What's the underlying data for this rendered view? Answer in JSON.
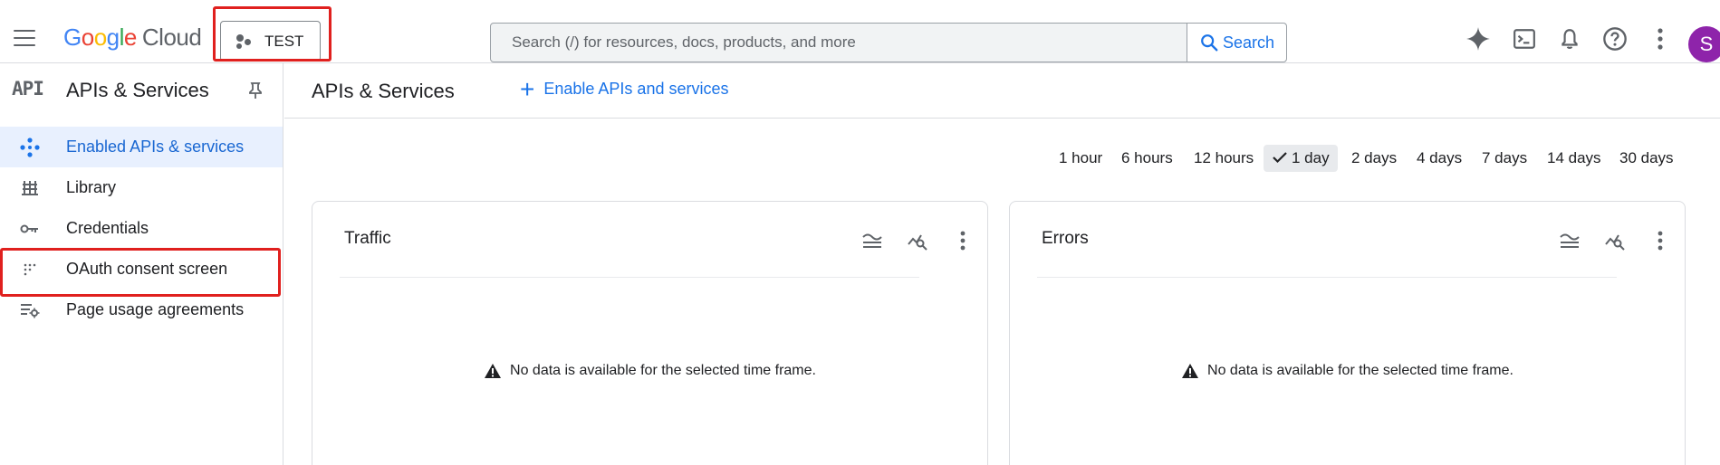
{
  "topbar": {
    "logo_google": [
      "G",
      "o",
      "o",
      "g",
      "l",
      "e"
    ],
    "logo_cloud": "Cloud",
    "project_label": "TEST",
    "search_placeholder": "Search (/) for resources, docs, products, and more",
    "search_button": "Search",
    "avatar_letter": "S"
  },
  "sidebar": {
    "badge": "API",
    "title": "APIs & Services",
    "items": [
      {
        "label": "Enabled APIs & services",
        "icon": "diamond-nodes-icon",
        "active": true
      },
      {
        "label": "Library",
        "icon": "library-icon",
        "active": false
      },
      {
        "label": "Credentials",
        "icon": "key-icon",
        "active": false
      },
      {
        "label": "OAuth consent screen",
        "icon": "consent-grid-icon",
        "active": false
      },
      {
        "label": "Page usage agreements",
        "icon": "settings-list-icon",
        "active": false
      }
    ]
  },
  "main": {
    "title": "APIs & Services",
    "enable_button": "Enable APIs and services",
    "time_ranges": [
      "1 hour",
      "6 hours",
      "12 hours",
      "1 day",
      "2 days",
      "4 days",
      "7 days",
      "14 days",
      "30 days"
    ],
    "selected_time_range": "1 day",
    "cards": [
      {
        "title": "Traffic",
        "message": "No data is available for the selected time frame."
      },
      {
        "title": "Errors",
        "message": "No data is available for the selected time frame."
      }
    ]
  },
  "colors": {
    "accent": "#1a73e8",
    "active_bg": "#e8f0fe",
    "highlight_box": "#e0201e",
    "avatar": "#8e24aa"
  }
}
